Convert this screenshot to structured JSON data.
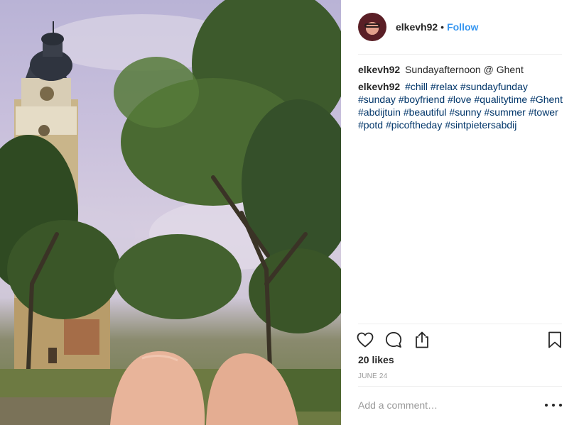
{
  "post": {
    "username": "elkevh92",
    "follow_label": "Follow",
    "separator": "•"
  },
  "caption": {
    "username": "elkevh92",
    "text": "Sundayafternoon @ Ghent"
  },
  "hashtag_comment": {
    "username": "elkevh92",
    "tags": [
      "#chill",
      "#relax",
      "#sundayfunday",
      "#sunday",
      "#boyfriend",
      "#love",
      "#qualitytime",
      "#Ghent",
      "#abdijtuin",
      "#beautiful",
      "#sunny",
      "#summer",
      "#tower",
      "#potd",
      "#picoftheday",
      "#sintpietersabdij"
    ]
  },
  "likes": "20 likes",
  "date": "JUNE 24",
  "comment_box": {
    "placeholder": "Add a comment…"
  },
  "icons": {
    "like": "heart-icon",
    "comment": "comment-bubble-icon",
    "share": "share-icon",
    "save": "bookmark-icon",
    "more": "more-options-icon"
  },
  "colors": {
    "link": "#3897f0",
    "hashtag": "#003569",
    "text": "#262626",
    "muted": "#999999",
    "divider": "#efefef"
  }
}
